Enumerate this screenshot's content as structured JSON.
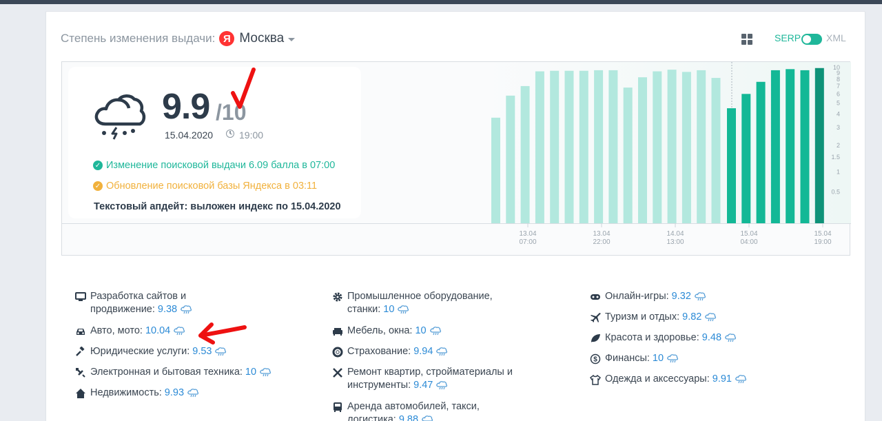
{
  "header": {
    "label": "Степень изменения выдачи:",
    "logo_letter": "Я",
    "city": "Москва",
    "serp_label": "SERP",
    "xml_label": "XML"
  },
  "weather": {
    "score": "9.9",
    "score_max": "/10",
    "date": "15.04.2020",
    "time": "19:00",
    "status_change": "Изменение поисковой выдачи 6.09 балла в 07:00",
    "status_update": "Обновление поисковой базы Яндекса в 03:11",
    "text_update": "Текстовый апдейт: выложен индекс по 15.04.2020"
  },
  "chart_data": {
    "type": "bar",
    "y_ticks": [
      "10",
      "9",
      "8",
      "7",
      "6",
      "5",
      "4",
      "3",
      "2",
      "1.5",
      "1",
      "0.5"
    ],
    "x_ticks": [
      {
        "date": "13.04",
        "time": "07:00"
      },
      {
        "date": "13.04",
        "time": "22:00"
      },
      {
        "date": "14.04",
        "time": "13:00"
      },
      {
        "date": "15.04",
        "time": "04:00"
      },
      {
        "date": "15.04",
        "time": "19:00"
      }
    ],
    "series": [
      {
        "values": [
          3.7,
          5.8,
          7.0,
          9.3,
          9.4,
          9.4,
          9.4,
          9.5,
          9.5,
          6.8,
          8.3,
          9.3,
          9.6,
          9.2,
          9.5,
          8.2
        ]
      },
      {
        "values": [
          4.5,
          6.0,
          7.6,
          9.5,
          9.7,
          9.5,
          9.9
        ]
      }
    ],
    "colors": {
      "past": "#b2e8de",
      "today": "#13b896",
      "current": "#0e9278"
    }
  },
  "categories": {
    "col1": [
      {
        "icon": "monitor-icon",
        "line1": "Разработка сайтов и",
        "line2": "продвижение:",
        "value": "9.38"
      },
      {
        "icon": "car-icon",
        "line1": "Авто, мото:",
        "value": "10.04"
      },
      {
        "icon": "gavel-icon",
        "line1": "Юридические услуги:",
        "value": "9.53"
      },
      {
        "icon": "plug-icon",
        "line1": "Электронная и бытовая техника:",
        "value": "10"
      },
      {
        "icon": "home-icon",
        "line1": "Недвижимость:",
        "value": "9.93"
      }
    ],
    "col2": [
      {
        "icon": "gear-icon",
        "line1": "Промышленное оборудование,",
        "line2": "станки:",
        "value": "10"
      },
      {
        "icon": "sofa-icon",
        "line1": "Мебель, окна:",
        "value": "10"
      },
      {
        "icon": "lifebuoy-icon",
        "line1": "Страхование:",
        "value": "9.94"
      },
      {
        "icon": "tools-icon",
        "line1": "Ремонт квартир, стройматериалы и",
        "line2": "инструменты:",
        "value": "9.47"
      },
      {
        "icon": "bus-icon",
        "line1": "Аренда автомобилей, такси,",
        "line2": "логистика:",
        "value": "9.88"
      }
    ],
    "col3": [
      {
        "icon": "gamepad-icon",
        "line1": "Онлайн-игры:",
        "value": "9.32"
      },
      {
        "icon": "plane-icon",
        "line1": "Туризм и отдых:",
        "value": "9.82"
      },
      {
        "icon": "leaf-icon",
        "line1": "Красота и здоровье:",
        "value": "9.48"
      },
      {
        "icon": "dollar-icon",
        "line1": "Финансы:",
        "value": "10"
      },
      {
        "icon": "shirt-icon",
        "line1": "Одежда и аксессуары:",
        "value": "9.91"
      }
    ]
  }
}
